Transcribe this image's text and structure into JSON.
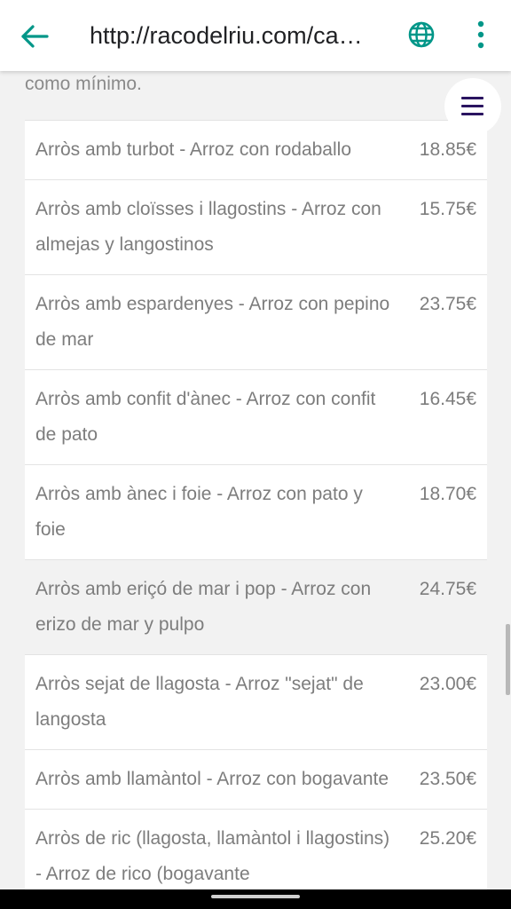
{
  "browser": {
    "url": "http://racodelriu.com/ca…",
    "back_icon": "arrow-left-icon",
    "globe_icon": "globe-icon",
    "more_icon": "more-vert-icon",
    "accent_color": "#009688"
  },
  "page": {
    "intro_text": "como mínimo.",
    "menu_icon": "hamburger-menu-icon",
    "menu_icon_color": "#2a1460",
    "items": [
      {
        "name": "Arròs amb turbot - Arroz con rodaballo",
        "price": "18.85€"
      },
      {
        "name": "Arròs amb cloïsses i llagostins - Arroz con almejas y langostinos",
        "price": "15.75€"
      },
      {
        "name": "Arròs amb espardenyes - Arroz con pepino de mar",
        "price": "23.75€"
      },
      {
        "name": "Arròs amb confit d'ànec - Arroz con confit de pato",
        "price": "16.45€"
      },
      {
        "name": "Arròs amb ànec i foie - Arroz con pato y foie",
        "price": "18.70€"
      },
      {
        "name": "Arròs amb eriçó de mar i pop - Arroz con erizo de mar y pulpo",
        "price": "24.75€"
      },
      {
        "name": "Arròs sejat de llagosta - Arroz \"sejat\" de langosta",
        "price": "23.00€"
      },
      {
        "name": "Arròs amb llamàntol - Arroz con bogavante",
        "price": "23.50€"
      },
      {
        "name": "Arròs de ric (llagosta, llamàntol i llagostins) - Arroz de rico (bogavante",
        "price": "25.20€"
      }
    ]
  }
}
